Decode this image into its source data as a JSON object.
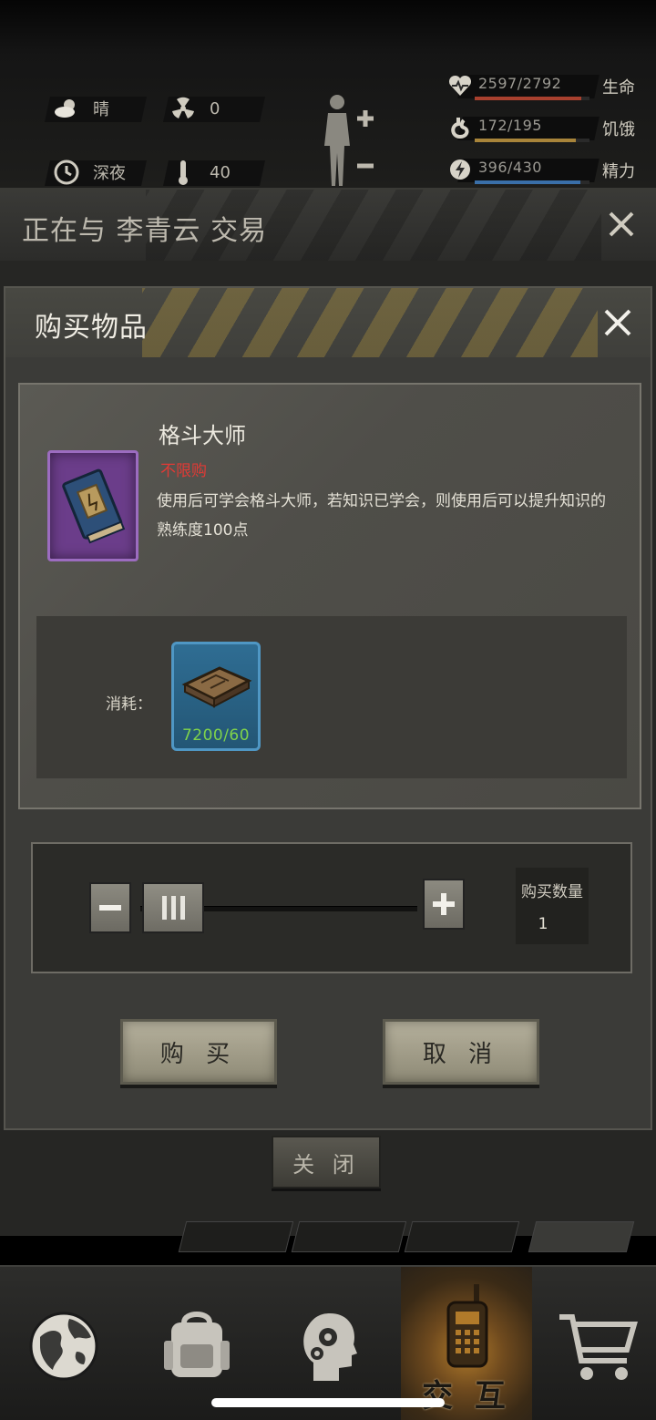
{
  "hud": {
    "weather": "晴",
    "radiation": "0",
    "time_of_day": "深夜",
    "temperature": "40",
    "stats": [
      {
        "value": "2597/2792",
        "label": "生命",
        "fill": 0.93,
        "color": "#a8402e",
        "icon": "heart-icon"
      },
      {
        "value": "172/195",
        "label": "饥饿",
        "fill": 0.88,
        "color": "#a8843a",
        "icon": "stomach-icon"
      },
      {
        "value": "396/430",
        "label": "精力",
        "fill": 0.92,
        "color": "#3a6fa8",
        "icon": "energy-icon"
      }
    ]
  },
  "trade": {
    "title": "正在与 李青云 交易",
    "close_label": "关 闭"
  },
  "dialog": {
    "title": "购买物品",
    "item": {
      "name": "格斗大师",
      "limit": "不限购",
      "description": "使用后可学会格斗大师，若知识已学会，则使用后可以提升知识的熟练度100点"
    },
    "cost_label": "消耗：",
    "cost_item": {
      "count": "7200/60"
    },
    "quantity_label": "购买数量",
    "quantity_value": "1",
    "buy_label": "购 买",
    "cancel_label": "取 消"
  },
  "bottom_nav": {
    "items": [
      {
        "name": "globe-icon"
      },
      {
        "name": "backpack-icon"
      },
      {
        "name": "skills-head-icon"
      },
      {
        "name": "radio-icon",
        "label": "交 互",
        "active": true
      },
      {
        "name": "cart-icon"
      }
    ]
  }
}
